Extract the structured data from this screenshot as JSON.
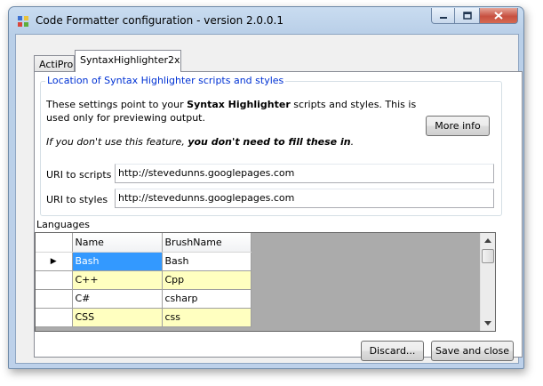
{
  "window": {
    "title": "Code Formatter configuration - version 2.0.0.1"
  },
  "tabs": [
    {
      "label": "ActiPro",
      "active": false
    },
    {
      "label": "SyntaxHighlighter2x",
      "active": true
    }
  ],
  "group": {
    "legend": "Location of Syntax Highlighter scripts and styles",
    "desc_prefix": "These settings point to your ",
    "desc_bold": "Syntax Highlighter",
    "desc_suffix": " scripts and styles.  This is used only for previewing output.",
    "note_prefix": "If you don't use this feature, ",
    "note_bold": "you don't need to fill these in",
    "note_suffix": ".",
    "more_info_label": "More info"
  },
  "fields": {
    "scripts_label": "URI to scripts",
    "scripts_value": "http://stevedunns.googlepages.com",
    "styles_label": "URI to styles",
    "styles_value": "http://stevedunns.googlepages.com"
  },
  "languages": {
    "label": "Languages",
    "columns": [
      "Name",
      "BrushName"
    ],
    "rows": [
      {
        "name": "Bash",
        "brush": "Bash"
      },
      {
        "name": "C++",
        "brush": "Cpp"
      },
      {
        "name": "C#",
        "brush": "csharp"
      },
      {
        "name": "CSS",
        "brush": "css"
      }
    ],
    "selected_row_indicator": "▶"
  },
  "footer": {
    "discard_label": "Discard...",
    "save_label": "Save and close"
  },
  "colors": {
    "legend": "#0032d4",
    "selection": "#3399ff",
    "alt_row": "#ffffc0"
  }
}
